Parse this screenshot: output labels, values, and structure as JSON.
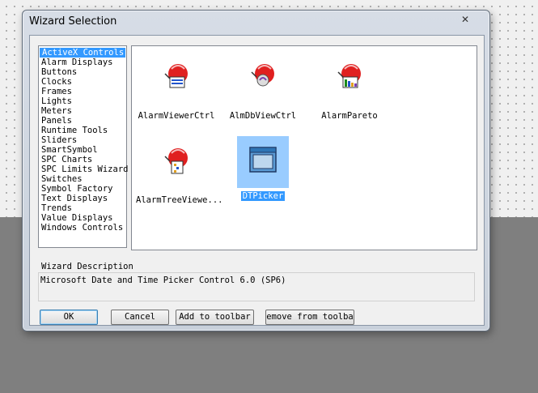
{
  "window": {
    "title": "Wizard Selection",
    "close_glyph": "✕"
  },
  "categories": [
    "ActiveX Controls",
    "Alarm Displays",
    "Buttons",
    "Clocks",
    "Frames",
    "Lights",
    "Meters",
    "Panels",
    "Runtime Tools",
    "Sliders",
    "SmartSymbol",
    "SPC Charts",
    "SPC Limits Wizard",
    "Switches",
    "Symbol Factory",
    "Text Displays",
    "Trends",
    "Value Displays",
    "Windows Controls"
  ],
  "selected_category": "ActiveX Controls",
  "icons": [
    {
      "label": "AlarmViewerCtrl",
      "icon": "alarm-viewer-icon"
    },
    {
      "label": "AlmDbViewCtrl",
      "icon": "alarm-db-view-icon"
    },
    {
      "label": "AlarmPareto",
      "icon": "alarm-pareto-icon"
    },
    {
      "label": "AlarmTreeViewe...",
      "icon": "alarm-tree-view-icon"
    },
    {
      "label": "DTPicker",
      "icon": "dt-picker-icon"
    }
  ],
  "selected_icon": "DTPicker",
  "description": {
    "label": "Wizard Description",
    "text": "Microsoft Date and Time Picker Control 6.0 (SP6)"
  },
  "buttons": {
    "ok": "OK",
    "cancel": "Cancel",
    "add_to_toolbar": "Add to toolbar",
    "remove_from_toolbar": "emove from  toolba"
  },
  "colors": {
    "selection": "#3399ff",
    "icon_red": "#e02020"
  }
}
